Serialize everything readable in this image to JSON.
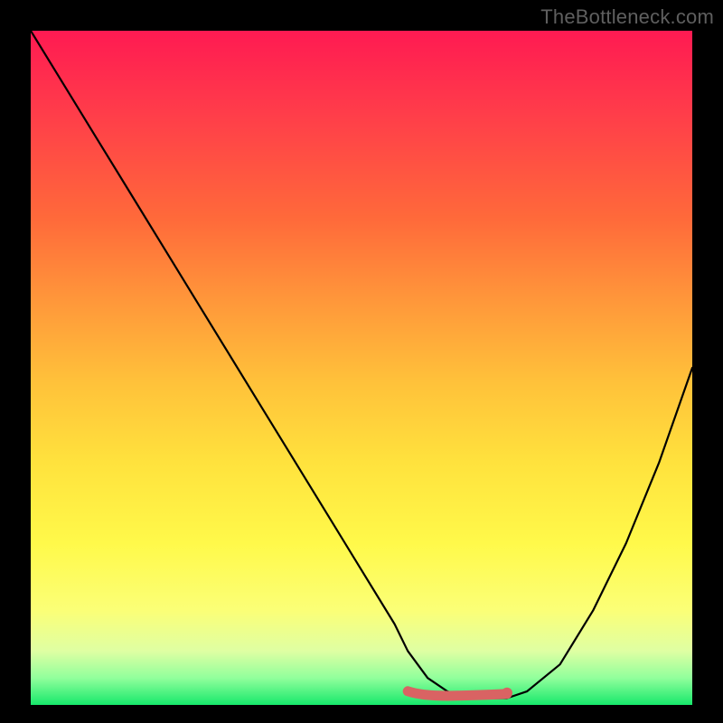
{
  "watermark": "TheBottleneck.com",
  "colors": {
    "frame_border": "#000000",
    "curve": "#000000",
    "highlight": "#d96363"
  },
  "chart_data": {
    "type": "line",
    "title": "",
    "xlabel": "",
    "ylabel": "",
    "xlim": [
      0,
      100
    ],
    "ylim": [
      0,
      100
    ],
    "grid": false,
    "legend": false,
    "series": [
      {
        "name": "curve",
        "x": [
          0,
          5,
          10,
          15,
          20,
          25,
          30,
          35,
          40,
          45,
          50,
          55,
          57,
          60,
          63,
          66,
          69,
          72,
          75,
          80,
          85,
          90,
          95,
          100
        ],
        "y": [
          100,
          92,
          84,
          76,
          68,
          60,
          52,
          44,
          36,
          28,
          20,
          12,
          8,
          4,
          2,
          1,
          1,
          1,
          2,
          6,
          14,
          24,
          36,
          50
        ]
      }
    ],
    "highlight_segment": {
      "range_x": [
        57,
        72
      ],
      "approx_y": 1.5,
      "note": "short thick pink segment near curve minimum"
    }
  }
}
